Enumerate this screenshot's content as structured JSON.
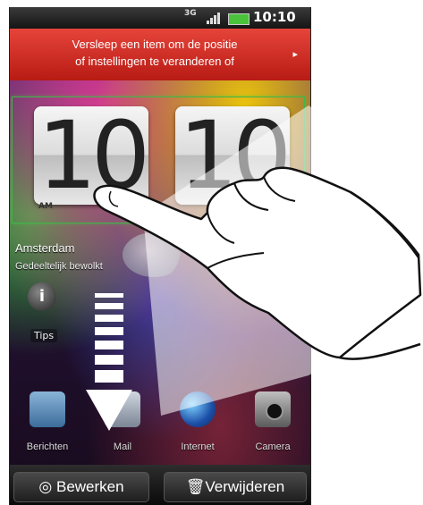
{
  "statusbar": {
    "network": "3G",
    "time": "10:10",
    "time_suffix": "AM"
  },
  "banner": {
    "line1": "Versleep een item om de positie",
    "line2": "of instellingen te veranderen of",
    "arrow_icon": "chevron-right-icon",
    "color": "#d2322a"
  },
  "clock": {
    "hours": "10",
    "minutes": "10",
    "ampm": "AM"
  },
  "weather": {
    "city": "Amsterdam",
    "description": "Gedeeltelijk bewolkt"
  },
  "shortcut": {
    "tips_label": "Tips"
  },
  "dock": [
    {
      "label": "Berichten",
      "icon": "messages-icon"
    },
    {
      "label": "Mail",
      "icon": "mail-icon"
    },
    {
      "label": "Internet",
      "icon": "globe-icon"
    },
    {
      "label": "Camera",
      "icon": "camera-icon"
    }
  ],
  "bottombar": {
    "edit_label": "Bewerken",
    "delete_label": "Verwijderen"
  }
}
